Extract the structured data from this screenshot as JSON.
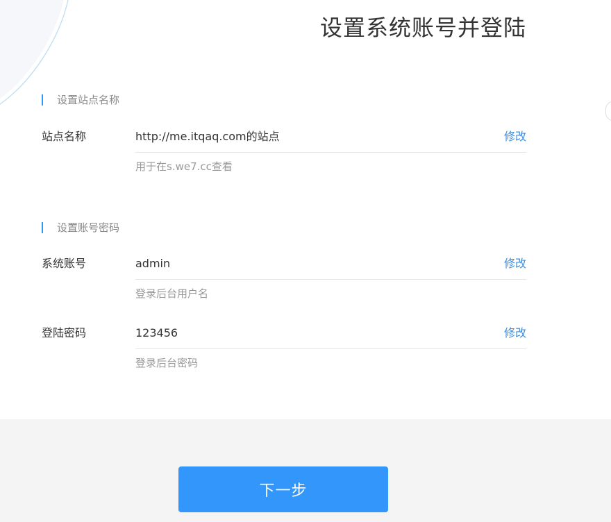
{
  "header": {
    "title": "设置系统账号并登陆"
  },
  "site_section": {
    "title": "设置站点名称",
    "site_name": {
      "label": "站点名称",
      "value": "http://me.itqaq.com的站点",
      "edit_label": "修改",
      "hint": "用于在s.we7.cc查看"
    }
  },
  "account_section": {
    "title": "设置账号密码",
    "account": {
      "label": "系统账号",
      "value": "admin",
      "edit_label": "修改",
      "hint": "登录后台用户名"
    },
    "password": {
      "label": "登陆密码",
      "value": "123456",
      "edit_label": "修改",
      "hint": "登录后台密码"
    }
  },
  "footer": {
    "next_label": "下一步"
  },
  "colors": {
    "accent": "#3296fa",
    "link": "#3a8ee6",
    "footer_bg": "#f4f4f4",
    "text": "#333333",
    "muted": "#999999"
  }
}
